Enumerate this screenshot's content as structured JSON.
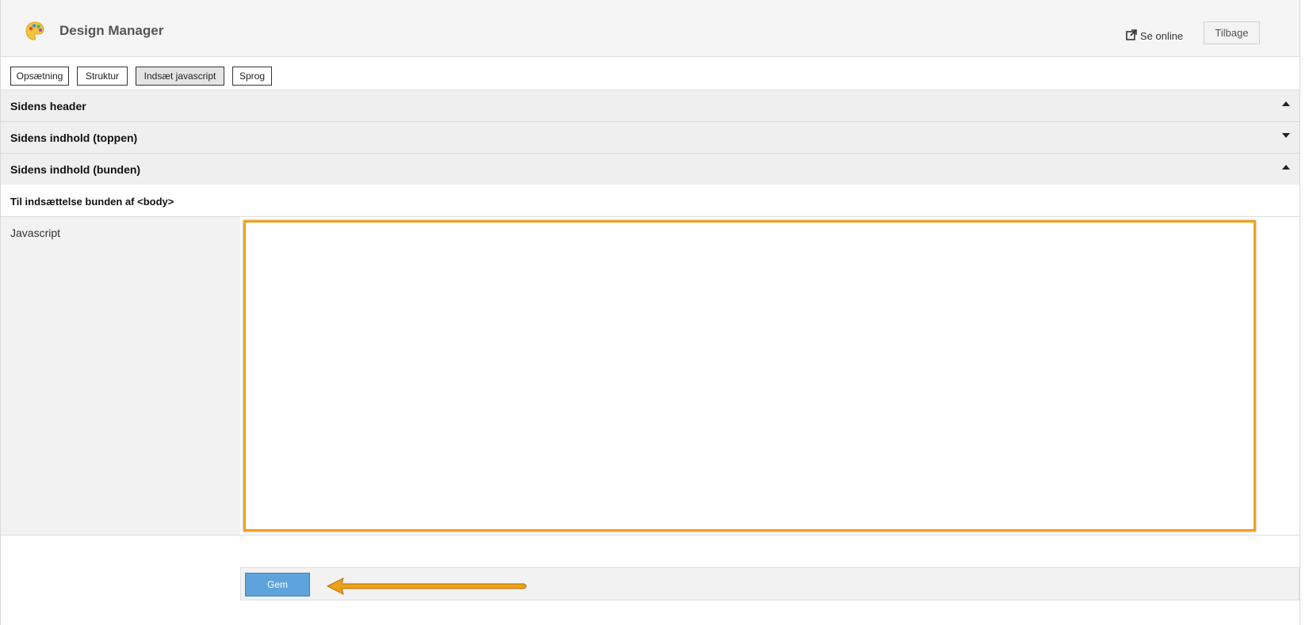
{
  "header": {
    "title": "Design Manager",
    "logo_icon": "palette-icon",
    "online_link": "Se online",
    "online_icon": "external-link-icon",
    "back_button": "Tilbage"
  },
  "tabs": [
    {
      "label": "Opsætning",
      "active": false
    },
    {
      "label": "Struktur",
      "active": false
    },
    {
      "label": "Indsæt javascript",
      "active": true
    },
    {
      "label": "Sprog",
      "active": false
    }
  ],
  "sections": [
    {
      "label": "Sidens header",
      "state": "collapsed",
      "caret": "caret-up-icon"
    },
    {
      "label": "Sidens indhold (toppen)",
      "state": "collapsed",
      "caret": "caret-down-icon"
    },
    {
      "label": "Sidens indhold (bunden)",
      "state": "expanded",
      "caret": "caret-up-icon"
    }
  ],
  "subsection": {
    "label": "Til indsættelse bunden af <body>"
  },
  "field": {
    "label": "Javascript",
    "value": ""
  },
  "actions": {
    "save_label": "Gem"
  },
  "colors": {
    "highlight": "#f0a019",
    "save_button": "#5ea3dc",
    "active_tab": "#e4e4e4",
    "section_bg": "#efefef"
  }
}
